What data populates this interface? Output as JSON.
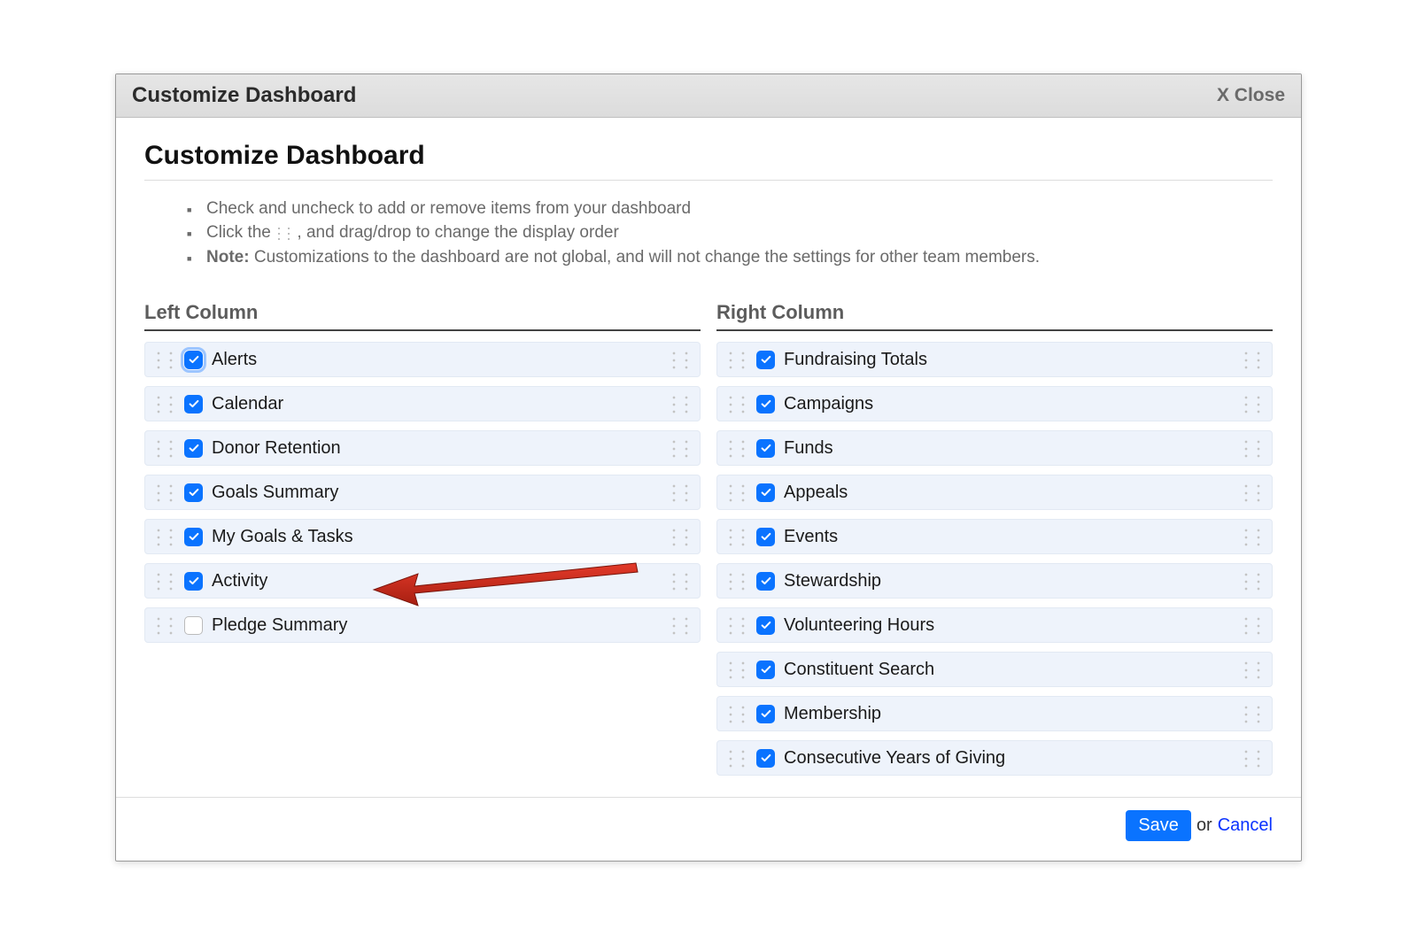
{
  "dialog": {
    "header_title": "Customize Dashboard",
    "close_label": "X Close",
    "page_title": "Customize Dashboard"
  },
  "instructions": {
    "li1": "Check and uncheck to add or remove items from your dashboard",
    "li2a": "Click the ",
    "li2b": ", and drag/drop to change the display order",
    "li3_note": "Note:",
    "li3_text": " Customizations to the dashboard are not global, and will not change the settings for other team members."
  },
  "columns": {
    "left_title": "Left Column",
    "right_title": "Right Column"
  },
  "left_items": [
    {
      "label": "Alerts",
      "checked": true,
      "glow": true
    },
    {
      "label": "Calendar",
      "checked": true,
      "glow": false
    },
    {
      "label": "Donor Retention",
      "checked": true,
      "glow": false
    },
    {
      "label": "Goals Summary",
      "checked": true,
      "glow": false
    },
    {
      "label": "My Goals & Tasks",
      "checked": true,
      "glow": false
    },
    {
      "label": "Activity",
      "checked": true,
      "glow": false
    },
    {
      "label": "Pledge Summary",
      "checked": false,
      "glow": false
    }
  ],
  "right_items": [
    {
      "label": "Fundraising Totals",
      "checked": true
    },
    {
      "label": "Campaigns",
      "checked": true
    },
    {
      "label": "Funds",
      "checked": true
    },
    {
      "label": "Appeals",
      "checked": true
    },
    {
      "label": "Events",
      "checked": true
    },
    {
      "label": "Stewardship",
      "checked": true
    },
    {
      "label": "Volunteering Hours",
      "checked": true
    },
    {
      "label": "Constituent Search",
      "checked": true
    },
    {
      "label": "Membership",
      "checked": true
    },
    {
      "label": "Consecutive Years of Giving",
      "checked": true
    }
  ],
  "footer": {
    "save": "Save",
    "or": "or",
    "cancel": "Cancel"
  }
}
